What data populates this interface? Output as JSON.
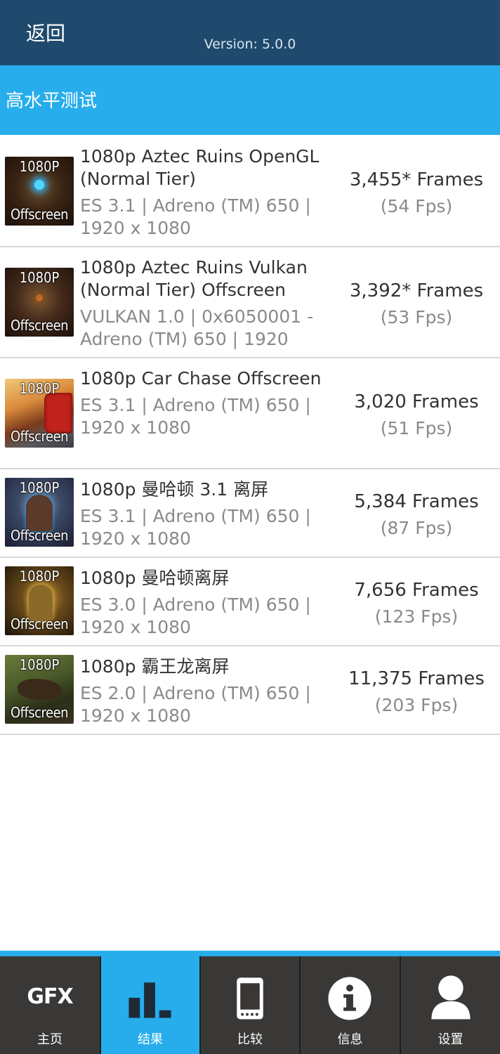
{
  "header": {
    "back_label": "返回",
    "version": "Version: 5.0.0"
  },
  "section": {
    "title": "高水平测试"
  },
  "results": [
    {
      "name": "1080p Aztec Ruins OpenGL (Normal Tier)",
      "detail": "ES 3.1 | Adreno (TM) 650 | 1920 x 1080",
      "frames": "3,455* Frames",
      "fps": "(54 Fps)",
      "thumb_top": "1080P",
      "thumb_bottom": "Offscreen"
    },
    {
      "name": "1080p Aztec Ruins Vulkan (Normal Tier) Offscreen",
      "detail": "VULKAN 1.0 | 0x6050001 - Adreno (TM) 650 | 1920",
      "frames": "3,392* Frames",
      "fps": "(53 Fps)",
      "thumb_top": "1080P",
      "thumb_bottom": "Offscreen"
    },
    {
      "name": "1080p Car Chase Offscreen",
      "detail": "ES 3.1 | Adreno (TM) 650 | 1920 x 1080",
      "frames": "3,020 Frames",
      "fps": "(51 Fps)",
      "thumb_top": "1080P",
      "thumb_bottom": "Offscreen"
    },
    {
      "name": "1080p 曼哈顿 3.1 离屏",
      "detail": "ES 3.1 | Adreno (TM) 650 | 1920 x 1080",
      "frames": "5,384 Frames",
      "fps": "(87 Fps)",
      "thumb_top": "1080P",
      "thumb_bottom": "Offscreen"
    },
    {
      "name": "1080p 曼哈顿离屏",
      "detail": "ES 3.0 | Adreno (TM) 650 | 1920 x 1080",
      "frames": "7,656 Frames",
      "fps": "(123 Fps)",
      "thumb_top": "1080P",
      "thumb_bottom": "Offscreen"
    },
    {
      "name": "1080p 霸王龙离屏",
      "detail": "ES 2.0 | Adreno (TM) 650 | 1920 x 1080",
      "frames": "11,375 Frames",
      "fps": "(203 Fps)",
      "thumb_top": "1080P",
      "thumb_bottom": "Offscreen"
    }
  ],
  "tabs": [
    {
      "label": "主页",
      "icon": "gfx-logo-icon",
      "icon_text": "GFX"
    },
    {
      "label": "结果",
      "icon": "bar-chart-icon",
      "active": true
    },
    {
      "label": "比较",
      "icon": "phone-icon"
    },
    {
      "label": "信息",
      "icon": "info-icon"
    },
    {
      "label": "设置",
      "icon": "user-icon"
    }
  ],
  "colors": {
    "header_bg": "#1f4a6d",
    "accent": "#27adec",
    "tabbar_bg": "#3a3836"
  }
}
